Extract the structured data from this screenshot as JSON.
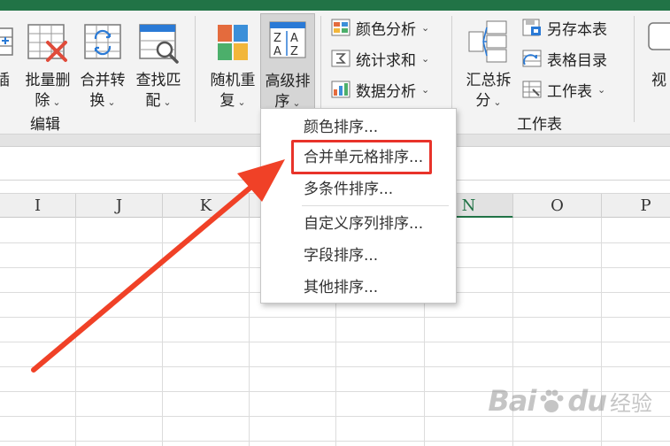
{
  "ribbon": {
    "buttons": [
      {
        "line1": "插",
        "line2": ""
      },
      {
        "line1": "批量删",
        "line2": "除"
      },
      {
        "line1": "合并转",
        "line2": "换"
      },
      {
        "line1": "查找匹",
        "line2": "配"
      },
      {
        "line1": "随机重",
        "line2": "复"
      },
      {
        "line1": "高级排",
        "line2": "序"
      },
      {
        "line1": "汇总拆",
        "line2": "分"
      },
      {
        "line1": "视",
        "line2": ""
      }
    ],
    "small_items": [
      {
        "label": "颜色分析"
      },
      {
        "label": "统计求和"
      },
      {
        "label": "数据分析"
      },
      {
        "label": "另存本表"
      },
      {
        "label": "表格目录"
      },
      {
        "label": "工作表"
      }
    ],
    "groups": {
      "edit": "编辑",
      "sheet": "工作表"
    }
  },
  "columns": [
    "I",
    "J",
    "K",
    "",
    "",
    "N",
    "O",
    "P"
  ],
  "selected_column": "N",
  "dropdown": {
    "items": [
      {
        "label": "颜色排序..."
      },
      {
        "label": "合并单元格排序..."
      },
      {
        "label": "多条件排序..."
      },
      {
        "label": "自定义序列排序..."
      },
      {
        "label": "字段排序..."
      },
      {
        "label": "其他排序..."
      }
    ],
    "highlighted_index": 1
  },
  "watermark": {
    "brand": "Bai",
    "brand_end": "du",
    "sub": "经验"
  },
  "colors": {
    "accent": "#217346",
    "highlight": "#e8332a",
    "arrow": "#f04127"
  }
}
